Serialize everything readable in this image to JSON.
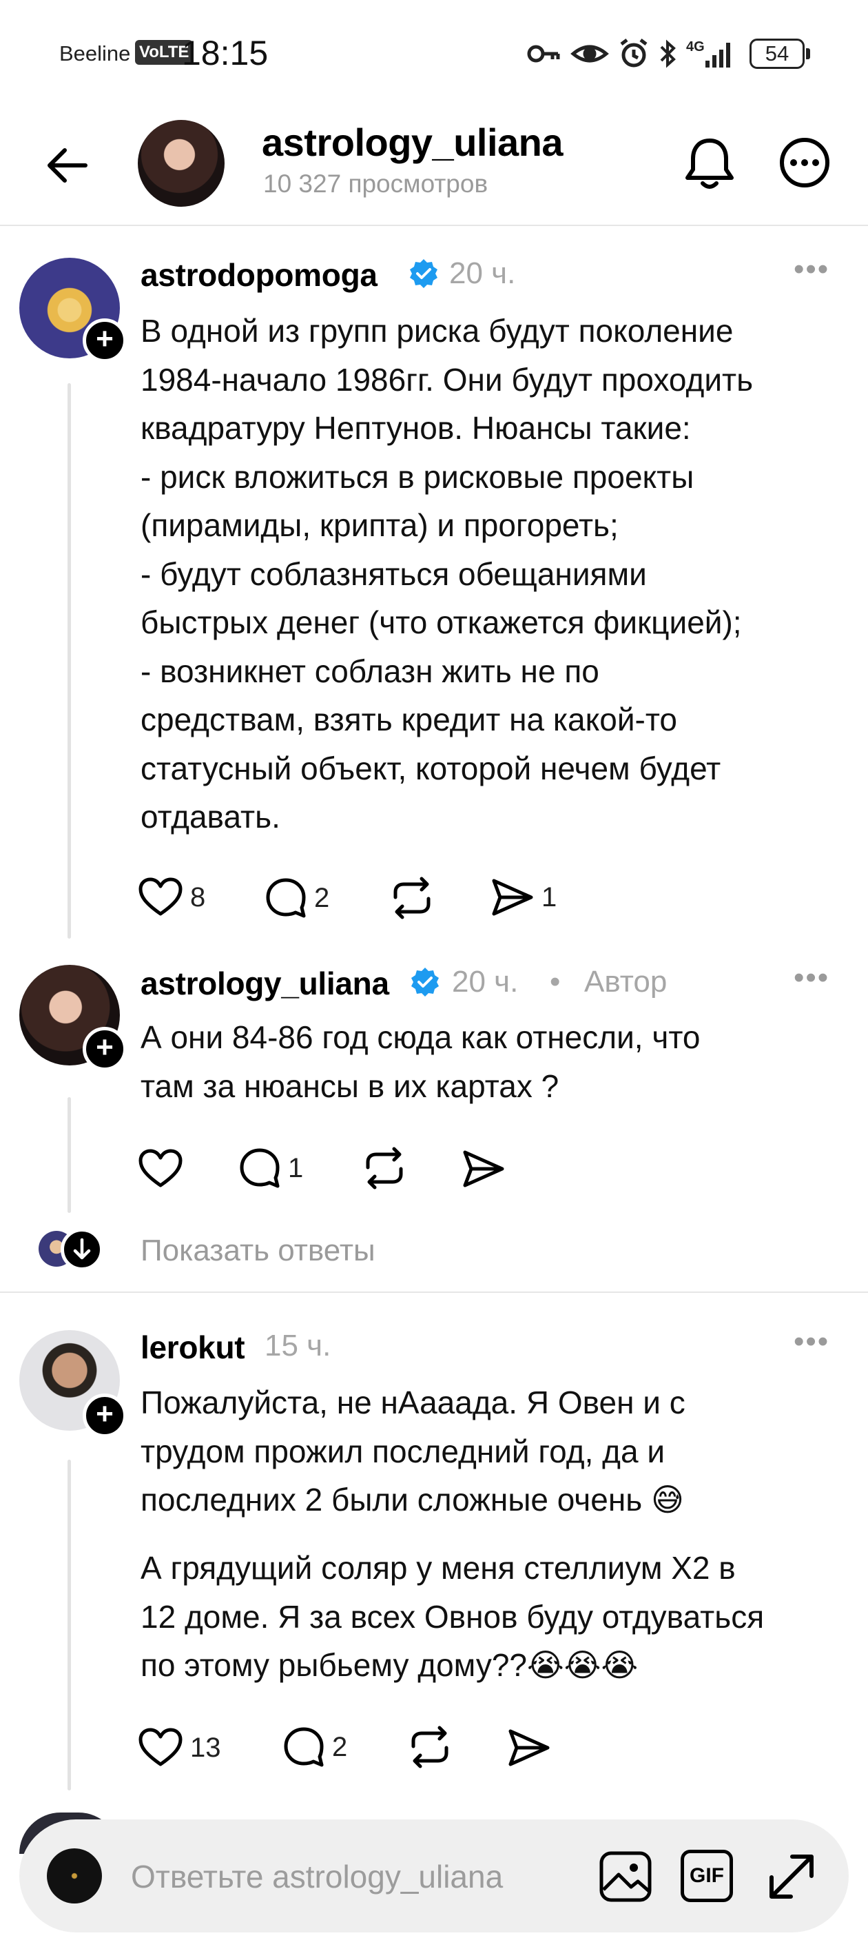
{
  "status_bar": {
    "carrier": "Beeline",
    "volte": "VoLTE",
    "time": "18:15",
    "network": "4G",
    "battery": "54"
  },
  "header": {
    "title": "astrology_uliana",
    "subtitle": "10 327 просмотров"
  },
  "posts": [
    {
      "username": "astrodopomoga",
      "verified": true,
      "time": "20 ч.",
      "body": "В одной из групп риска будут поколение\n1984-начало 1986гг. Они будут проходить\nквадратуру Нептунов. Нюансы такие:\n- риск вложиться в рисковые проекты\n(пирамиды, крипта) и прогореть;\n- будут соблазняться обещаниями\nбыстрых денег (что откажется фикцией);\n- возникнет соблазн жить не по\nсредствам, взять кредит на какой-то\nстатусный объект, которой нечем будет\nотдавать.",
      "likes": "8",
      "replies": "2",
      "shares": "1"
    },
    {
      "username": "astrology_uliana",
      "verified": true,
      "time": "20 ч.",
      "separator": "•",
      "role": "Автор",
      "body": "А они 84-86 год сюда как отнесли, что\nтам за нюансы в их картах ?",
      "replies": "1"
    },
    {
      "username": "lerokut",
      "verified": false,
      "time": "15 ч.",
      "body": "Пожалуйста, не нАааада. Я Овен и с\nтрудом прожил последний год, да и\nпоследних 2 были сложные очень 😅",
      "body2": "А грядущий соляр у меня стеллиум Х2 в\n12 доме. Я за всех Овнов буду отдуваться\nпо этому рыбьему дому??😭😭😭",
      "likes": "13",
      "replies": "2"
    }
  ],
  "show_replies": "Показать ответы",
  "compose": {
    "placeholder": "Ответьте astrology_uliana",
    "gif_label": "GIF"
  },
  "colors": {
    "verified": "#1d9bf0",
    "muted": "#9a9a9a",
    "divider": "#e6e6e6"
  }
}
